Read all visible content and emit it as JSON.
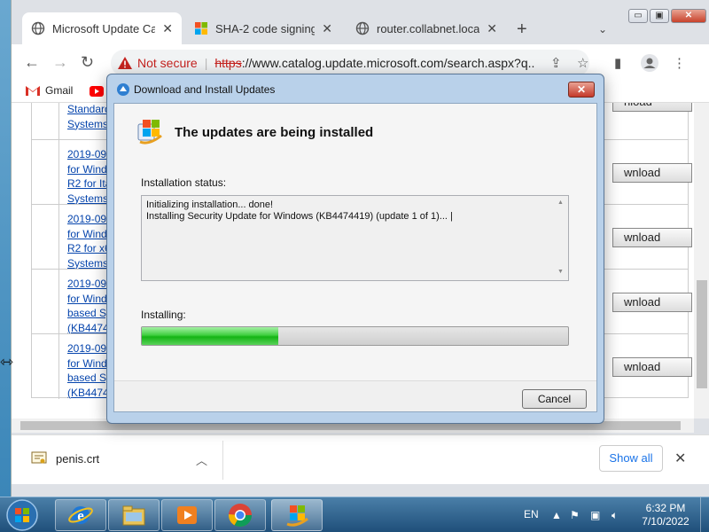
{
  "browser": {
    "tabs": [
      {
        "title": "Microsoft Update Cata",
        "active": true
      },
      {
        "title": "SHA-2 code signing s",
        "active": false
      },
      {
        "title": "router.collabnet.local",
        "active": false
      }
    ],
    "new_tab": "+",
    "tab_close": "✕",
    "window_buttons": {
      "minimize": "▭",
      "restore": "▣",
      "close": "✕"
    },
    "nav": {
      "back": "←",
      "forward": "→",
      "reload": "↻"
    },
    "address": {
      "security_label": "Not secure",
      "separator": "|",
      "scheme": "https",
      "rest": "://www.catalog.update.microsoft.com/search.aspx?q..."
    },
    "bookmarks": [
      {
        "label": "Gmail"
      }
    ]
  },
  "results": {
    "rows": [
      {
        "link": "Standard\nSystems",
        "download": "nload"
      },
      {
        "link": "2019-09\nfor Wind\nR2 for Ita\nSystems",
        "download": "wnload"
      },
      {
        "link": "2019-09\nfor Wind\nR2 for x6\nSystems",
        "download": "wnload"
      },
      {
        "link": "2019-09\nfor Wind\nbased Sy\n(KB4474",
        "download": "wnload"
      },
      {
        "link": "2019-09\nfor Wind\nbased Sy\n(KB4474",
        "download": "wnload"
      }
    ]
  },
  "downloads_bar": {
    "file": "penis.crt",
    "show_all": "Show all",
    "close": "✕"
  },
  "dialog": {
    "title": "Download and Install Updates",
    "close": "✕",
    "heading": "The updates are being installed",
    "status_label": "Installation status:",
    "status_lines": [
      "Initializing installation... done!",
      "Installing Security Update for Windows (KB4474419) (update 1 of 1)... |"
    ],
    "progress_label": "Installing:",
    "progress_fraction": 0.32,
    "cancel": "Cancel"
  },
  "taskbar": {
    "language": "EN",
    "time": "6:32 PM",
    "date": "7/10/2022"
  },
  "colors": {
    "not_secure": "#c5221f",
    "link": "#0645ad",
    "progress_green": "#14b414",
    "taskbar": "#1f4f7a"
  }
}
